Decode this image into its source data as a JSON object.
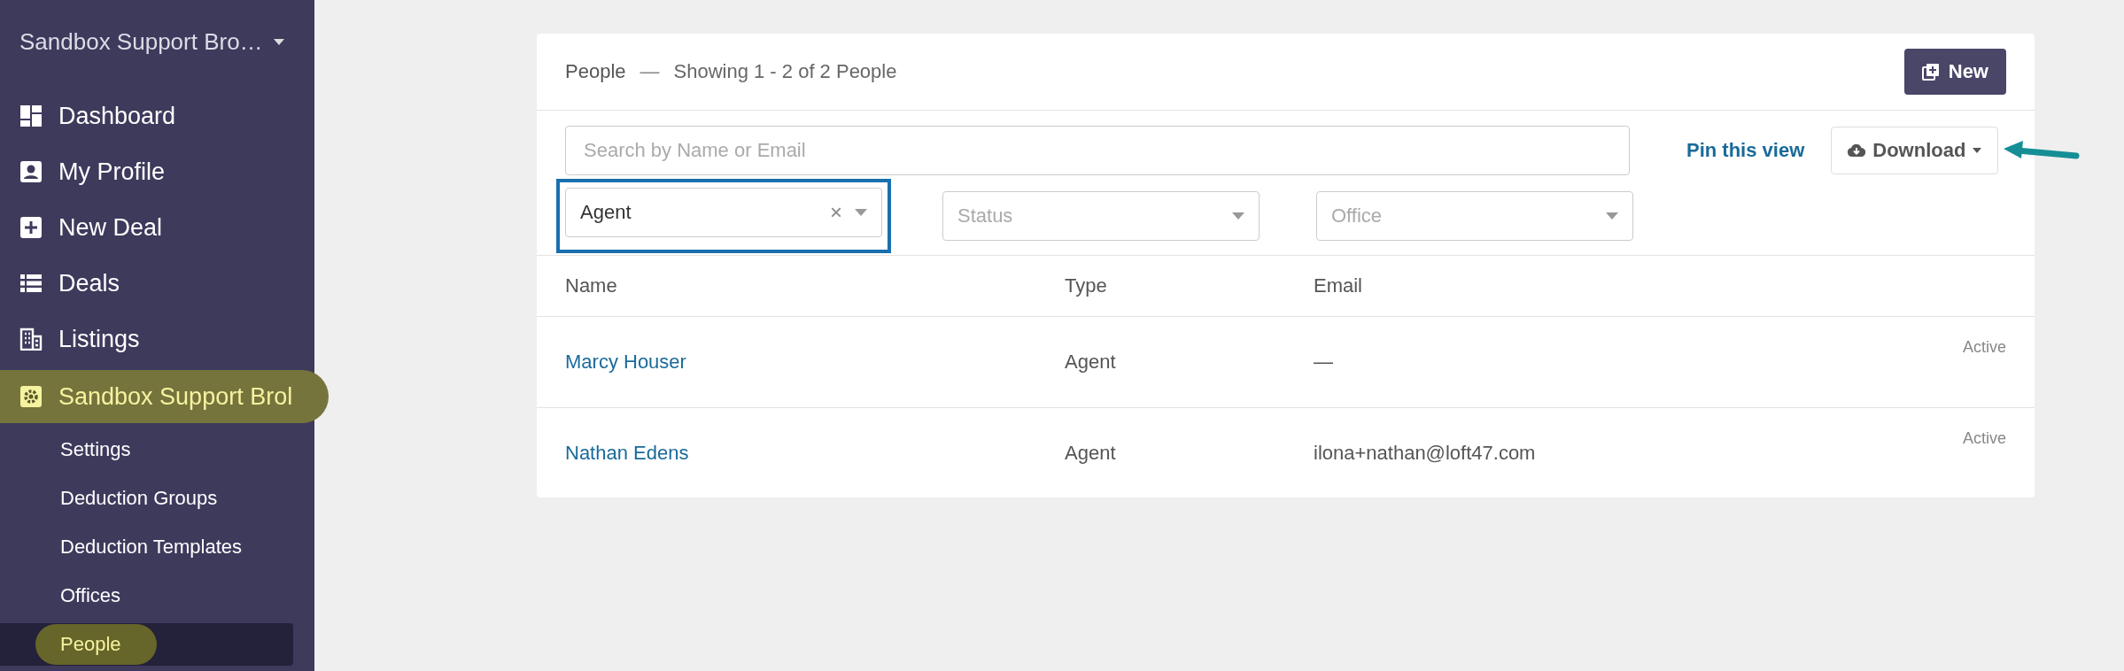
{
  "sidebar": {
    "org_switcher": "Sandbox Support Bro…",
    "items": [
      {
        "label": "Dashboard",
        "kind": "dashboard",
        "highlighted": false
      },
      {
        "label": "My Profile",
        "kind": "profile",
        "highlighted": false
      },
      {
        "label": "New Deal",
        "kind": "plus",
        "highlighted": false
      },
      {
        "label": "Deals",
        "kind": "list",
        "highlighted": false
      },
      {
        "label": "Listings",
        "kind": "building",
        "highlighted": false
      },
      {
        "label": "Sandbox Support Brol",
        "kind": "gear",
        "highlighted": true,
        "children": [
          {
            "label": "Settings",
            "selected": false,
            "highlighted": false
          },
          {
            "label": "Deduction Groups",
            "selected": false,
            "highlighted": false
          },
          {
            "label": "Deduction Templates",
            "selected": false,
            "highlighted": false
          },
          {
            "label": "Offices",
            "selected": false,
            "highlighted": false
          },
          {
            "label": "People",
            "selected": true,
            "highlighted": true
          }
        ]
      }
    ]
  },
  "card": {
    "title": "People",
    "separator": "—",
    "summary": "Showing 1 - 2 of 2 People",
    "new_button": "New",
    "search": {
      "placeholder": "Search by Name or Email"
    },
    "pin_link": "Pin this view",
    "download_button": "Download",
    "filters": [
      {
        "value": "Agent",
        "clear_icon": "×",
        "outlined": true
      },
      {
        "placeholder": "Status",
        "outlined": false
      },
      {
        "placeholder": "Office",
        "outlined": false
      }
    ],
    "table": {
      "columns": [
        "Name",
        "Type",
        "Email"
      ],
      "rows": [
        {
          "name": "Marcy Houser",
          "type": "Agent",
          "email": "—",
          "status": "Active"
        },
        {
          "name": "Nathan Edens",
          "type": "Agent",
          "email": "ilona+nathan@loft47.com",
          "status": "Active"
        }
      ]
    }
  }
}
